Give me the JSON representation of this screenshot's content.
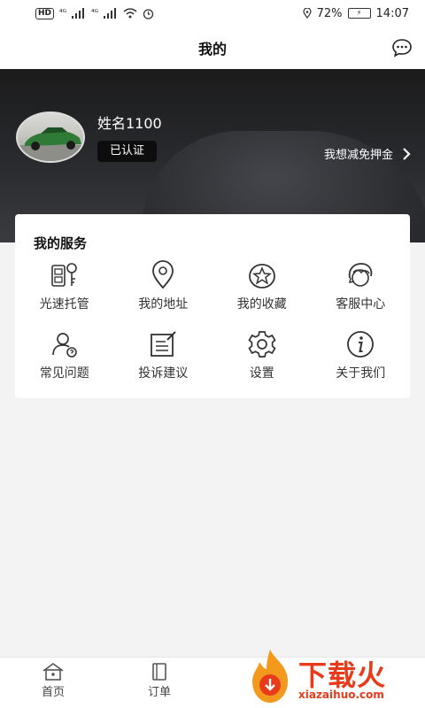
{
  "status_bar": {
    "hd": "HD",
    "sig1": "⁴ᴳ",
    "sig2": "⁴ᴳ",
    "battery_pct": "72%",
    "time": "14:07"
  },
  "nav": {
    "title": "我的"
  },
  "profile": {
    "name": "姓名1100",
    "verified": "已认证",
    "deposit_link": "我想减免押金"
  },
  "services": {
    "title": "我的服务",
    "items": [
      {
        "label": "光速托管",
        "icon": "key-fob-icon"
      },
      {
        "label": "我的地址",
        "icon": "location-pin-icon"
      },
      {
        "label": "我的收藏",
        "icon": "star-icon"
      },
      {
        "label": "客服中心",
        "icon": "headset-icon"
      },
      {
        "label": "常见问题",
        "icon": "user-help-icon"
      },
      {
        "label": "投诉建议",
        "icon": "feedback-icon"
      },
      {
        "label": "设置",
        "icon": "gear-icon"
      },
      {
        "label": "关于我们",
        "icon": "info-icon"
      }
    ]
  },
  "tabs": [
    {
      "label": "首页",
      "icon": "home-icon"
    },
    {
      "label": "订单",
      "icon": "order-book-icon"
    }
  ],
  "watermark": {
    "text": "下载火",
    "sub": "xiazaihuo.com"
  },
  "colors": {
    "accent": "#e83b1b",
    "banner": "#1b1b1c"
  }
}
